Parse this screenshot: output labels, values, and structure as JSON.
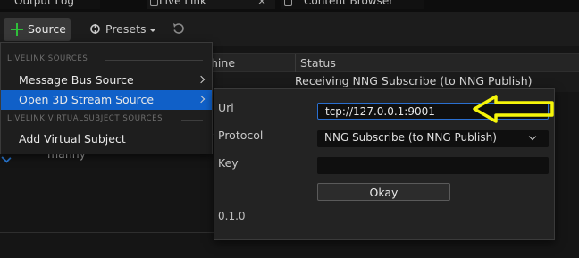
{
  "tabs": [
    {
      "label": "Output Log"
    },
    {
      "label": "Live Link",
      "close": "×"
    },
    {
      "label": "Content Browser"
    }
  ],
  "toolbar": {
    "source_label": "Source",
    "presets_label": "Presets"
  },
  "table": {
    "col_machine": "hine",
    "col_status": "Status",
    "row_status": "Receiving NNG Subscribe (to NNG Publish)",
    "subject_name": "manny"
  },
  "menu": {
    "section_sources": "LIVELINK SOURCES",
    "message_bus_source": "Message Bus Source",
    "open_3d_stream_source": "Open 3D Stream Source",
    "section_virtual": "LIVELINK VIRTUALSUBJECT SOURCES",
    "add_virtual_subject": "Add Virtual Subject"
  },
  "panel": {
    "url_label": "Url",
    "url_value": "tcp://127.0.0.1:9001",
    "protocol_label": "Protocol",
    "protocol_value": "NNG Subscribe (to NNG Publish)",
    "key_label": "Key",
    "key_value": "",
    "okay_label": "Okay",
    "version": "0.1.0"
  },
  "colors": {
    "accent": "#1060c8",
    "add_green": "#2fbf3a",
    "annotation_arrow": "#f5f50a"
  }
}
